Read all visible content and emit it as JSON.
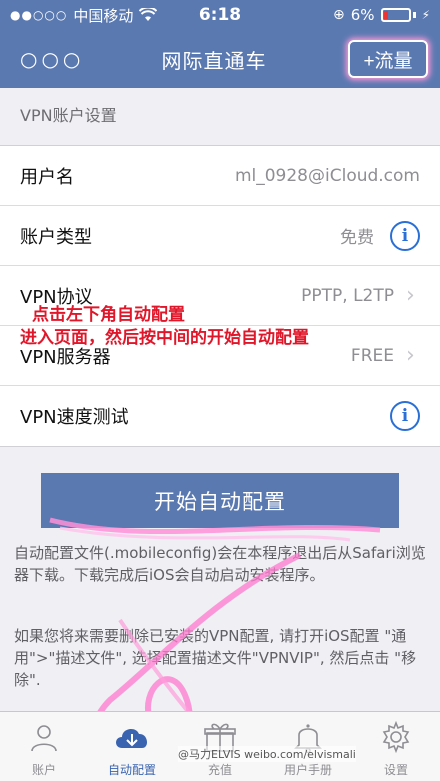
{
  "status_bar": {
    "signal": "●●○○○",
    "carrier": "中国移动",
    "time": "6:18",
    "battery": "6%"
  },
  "nav": {
    "more": "○○○",
    "title": "网际直通车",
    "traffic_button": "+流量"
  },
  "section_header": "VPN账户设置",
  "rows": [
    {
      "label": "用户名",
      "value": "ml_0928@iCloud.com"
    },
    {
      "label": "账户类型",
      "value": "免费"
    },
    {
      "label": "VPN协议",
      "value": "PPTP, L2TP"
    },
    {
      "label": "VPN服务器",
      "value": "FREE"
    },
    {
      "label": "VPN速度测试",
      "value": ""
    }
  ],
  "annotation": {
    "line1": "点击左下角自动配置",
    "line2": "进入页面，然后按中间的开始自动配置"
  },
  "start_button": "开始自动配置",
  "help": {
    "p1": "自动配置文件(.mobileconfig)会在本程序退出后从Safari浏览器下载。下载完成后iOS会自动启动安装程序。",
    "p2": "如果您将来需要删除已安装的VPN配置, 请打开iOS配置 \"通用\">\"描述文件\", 选择配置描述文件\"VPNVIP\", 然后点击 \"移除\"."
  },
  "tabs": [
    {
      "label": "账户",
      "icon": "person-icon"
    },
    {
      "label": "自动配置",
      "icon": "cloud-download-icon"
    },
    {
      "label": "充值",
      "icon": "gift-icon"
    },
    {
      "label": "用户手册",
      "icon": "bell-icon"
    },
    {
      "label": "设置",
      "icon": "gear-icon"
    }
  ],
  "watermark": "@马力ELVIS weibo.com/elvismali",
  "colors": {
    "accent": "#5b79b1",
    "annotation": "#e0172a",
    "info": "#2a6fd6"
  }
}
